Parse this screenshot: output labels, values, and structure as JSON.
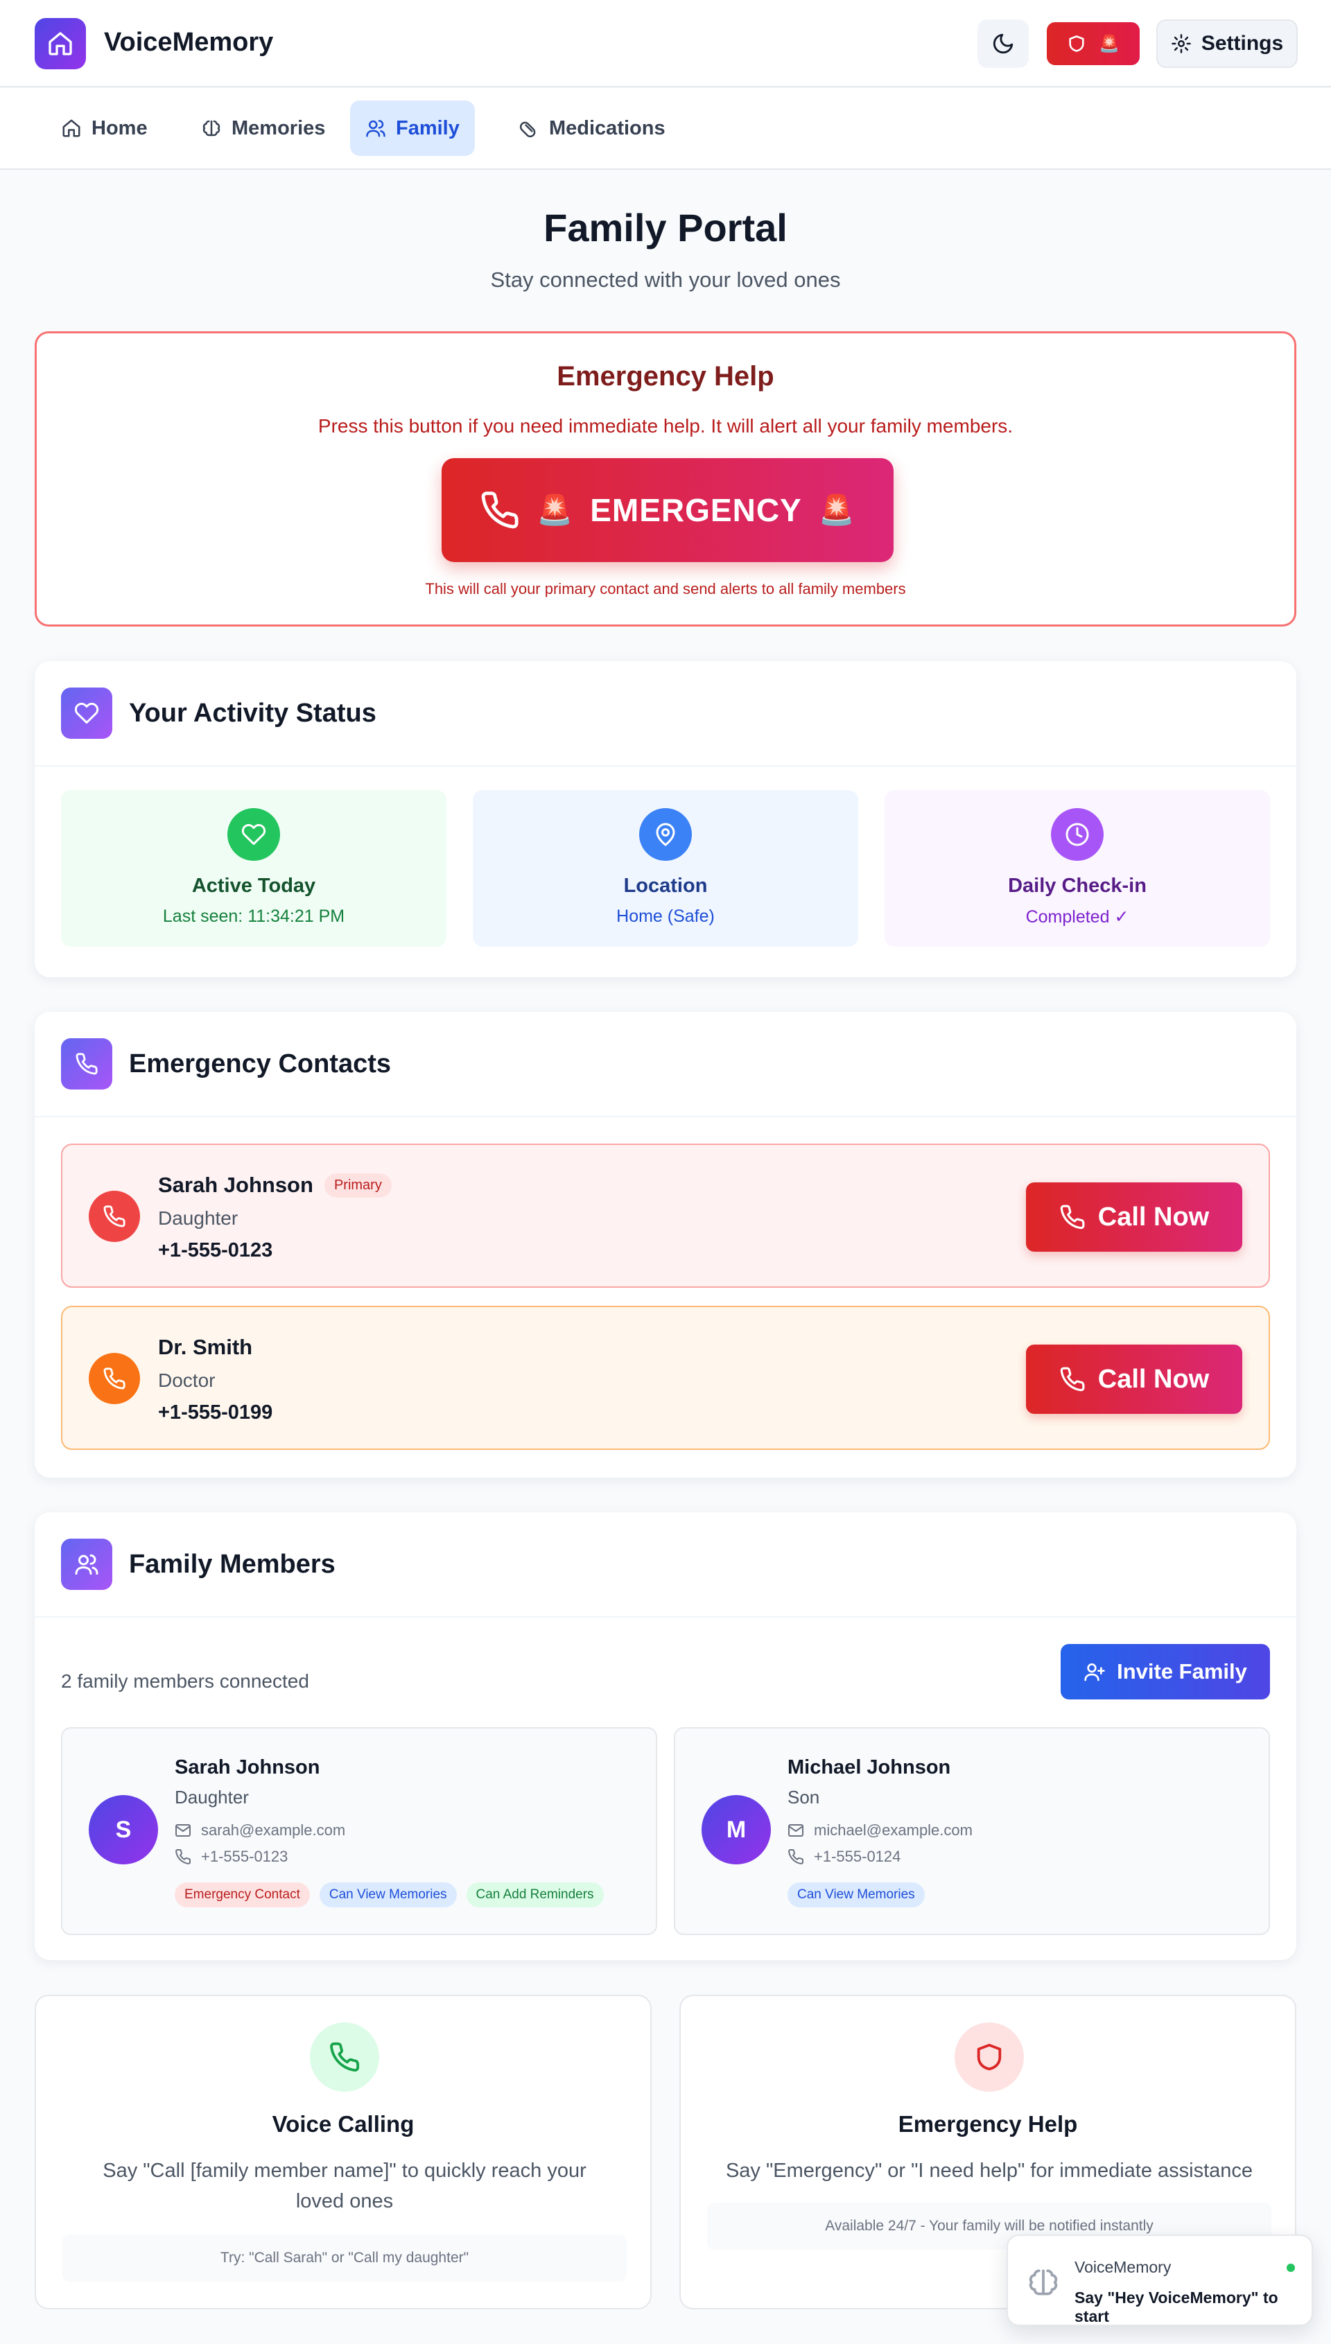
{
  "app": {
    "title": "VoiceMemory"
  },
  "header": {
    "settings_label": "Settings",
    "sos_emoji": "🚨"
  },
  "nav": {
    "tabs": [
      {
        "label": "Home",
        "icon": "home-icon",
        "active": false
      },
      {
        "label": "Memories",
        "icon": "brain-icon",
        "active": false
      },
      {
        "label": "Family",
        "icon": "users-icon",
        "active": true
      },
      {
        "label": "Medications",
        "icon": "pill-icon",
        "active": false
      }
    ]
  },
  "page": {
    "title": "Family Portal",
    "subtitle": "Stay connected with your loved ones"
  },
  "emergency": {
    "title": "Emergency Help",
    "description": "Press this button if you need immediate help. It will alert all your family members.",
    "button_label": "EMERGENCY",
    "siren": "🚨",
    "note": "This will call your primary contact and send alerts to all family members"
  },
  "activity": {
    "title": "Your Activity Status",
    "items": [
      {
        "title": "Active Today",
        "subtitle": "Last seen: 11:34:21 PM",
        "icon": "heart-icon",
        "color": "#22c55e"
      },
      {
        "title": "Location",
        "subtitle": "Home (Safe)",
        "icon": "map-pin-icon",
        "color": "#3b82f6"
      },
      {
        "title": "Daily Check-in",
        "subtitle": "Completed ✓",
        "icon": "clock-icon",
        "color": "#a855f7"
      }
    ]
  },
  "contacts": {
    "title": "Emergency Contacts",
    "call_label": "Call Now",
    "items": [
      {
        "name": "Sarah Johnson",
        "badge": "Primary",
        "relation": "Daughter",
        "phone": "+1-555-0123",
        "color": "#ef4444"
      },
      {
        "name": "Dr. Smith",
        "badge": "",
        "relation": "Doctor",
        "phone": "+1-555-0199",
        "color": "#f97316"
      }
    ]
  },
  "family": {
    "title": "Family Members",
    "count_text": "2 family members connected",
    "invite_label": "Invite Family",
    "members": [
      {
        "initial": "S",
        "name": "Sarah Johnson",
        "relation": "Daughter",
        "email": "sarah@example.com",
        "phone": "+1-555-0123",
        "tags": [
          "Emergency Contact",
          "Can View Memories",
          "Can Add Reminders"
        ]
      },
      {
        "initial": "M",
        "name": "Michael Johnson",
        "relation": "Son",
        "email": "michael@example.com",
        "phone": "+1-555-0124",
        "tags": [
          "Can View Memories"
        ]
      }
    ]
  },
  "info": {
    "voice": {
      "title": "Voice Calling",
      "description": "Say \"Call [family member name]\" to quickly reach your loved ones",
      "tip": "Try: \"Call Sarah\" or \"Call my daughter\""
    },
    "help": {
      "title": "Emergency Help",
      "description": "Say \"Emergency\" or \"I need help\" for immediate assistance",
      "tip": "Available 24/7 - Your family will be notified instantly"
    }
  },
  "widget": {
    "name": "VoiceMemory",
    "hint": "Say \"Hey VoiceMemory\" to start"
  }
}
